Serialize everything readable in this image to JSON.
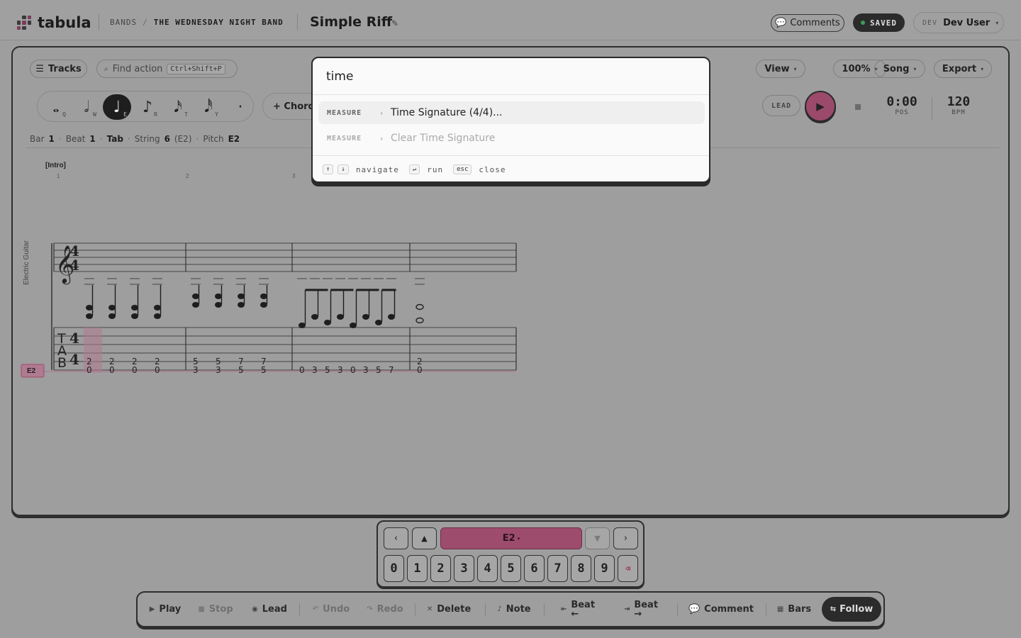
{
  "app": {
    "name": "tabula"
  },
  "breadcrumb": {
    "section": "BANDS",
    "separator": "/",
    "band": "THE WEDNESDAY NIGHT BAND"
  },
  "song": {
    "title": "Simple Riff",
    "edit_icon": "✎"
  },
  "header": {
    "comments_label": "Comments",
    "saved_label": "SAVED",
    "user_env": "DEV",
    "user_name": "Dev User"
  },
  "toolbar_top": {
    "tracks_label": "Tracks",
    "find_action_label": "Find action",
    "find_action_shortcut": "Ctrl+Shift+P",
    "view_label": "View",
    "zoom_label": "100%",
    "song_label": "Song",
    "export_label": "Export"
  },
  "durations": [
    {
      "glyph": "𝅝",
      "key": "Q"
    },
    {
      "glyph": "𝅗𝅥",
      "key": "W"
    },
    {
      "glyph": "♩",
      "key": "E",
      "active": true
    },
    {
      "glyph": "♪",
      "key": "R"
    },
    {
      "glyph": "𝅘𝅥𝅯",
      "key": "T"
    },
    {
      "glyph": "𝅘𝅥𝅰",
      "key": "Y"
    },
    {
      "glyph": "·",
      "key": ""
    }
  ],
  "chord_label": "+ Chord",
  "transport": {
    "lead_label": "LEAD",
    "position_value": "0:00",
    "position_label": "POS",
    "bpm_value": "120",
    "bpm_label": "BPM"
  },
  "status": {
    "bar_label": "Bar",
    "bar_value": "1",
    "beat_label": "Beat",
    "beat_value": "1",
    "mode_value": "Tab",
    "string_label": "String",
    "string_value": "6",
    "string_note": "(E2)",
    "pitch_label": "Pitch",
    "pitch_value": "E2"
  },
  "score": {
    "section_marker": "[Intro]",
    "track_name": "Electric Guitar",
    "time_signature": "4/4",
    "string_indicator": "E2",
    "measure_numbers": [
      "1",
      "2",
      "3"
    ],
    "measures": [
      {
        "notes": [
          {
            "top": "2",
            "bottom": "0"
          },
          {
            "top": "2",
            "bottom": "0"
          },
          {
            "top": "2",
            "bottom": "0"
          },
          {
            "top": "2",
            "bottom": "0"
          }
        ]
      },
      {
        "notes": [
          {
            "top": "5",
            "bottom": "3"
          },
          {
            "top": "5",
            "bottom": "3"
          },
          {
            "top": "7",
            "bottom": "5"
          },
          {
            "top": "7",
            "bottom": "5"
          }
        ]
      },
      {
        "notes": [
          {
            "bottom": "0"
          },
          {
            "bottom": "3"
          },
          {
            "bottom": "5"
          },
          {
            "bottom": "3"
          },
          {
            "bottom": "0"
          },
          {
            "bottom": "3"
          },
          {
            "bottom": "5"
          },
          {
            "bottom": "7"
          }
        ]
      },
      {
        "notes": [
          {
            "top": "2",
            "bottom": "0"
          }
        ]
      }
    ]
  },
  "palette": {
    "query": "time",
    "results": [
      {
        "category": "MEASURE",
        "label": "Time Signature (4/4)..."
      },
      {
        "category": "MEASURE",
        "label": "Clear Time Signature"
      }
    ],
    "footer": {
      "up_key": "↑",
      "down_key": "↓",
      "navigate_label": "navigate",
      "enter_key": "↵",
      "run_label": "run",
      "esc_key": "esc",
      "close_label": "close"
    }
  },
  "keypad": {
    "prev_label": "‹",
    "up_label": "▲",
    "string_label": "E2",
    "string_caret": "▾",
    "down_label": "▼",
    "next_label": "›",
    "digits": [
      "0",
      "1",
      "2",
      "3",
      "4",
      "5",
      "6",
      "7",
      "8",
      "9"
    ],
    "delete_label": "⌫"
  },
  "bottom_toolbar": {
    "play_label": "Play",
    "stop_label": "Stop",
    "lead_label": "Lead",
    "undo_label": "Undo",
    "redo_label": "Redo",
    "delete_label": "Delete",
    "note_label": "Note",
    "beat_back_label": "Beat",
    "beat_back_arrow": "←",
    "beat_fwd_label": "Beat",
    "beat_fwd_arrow": "→",
    "comment_label": "Comment",
    "bars_label": "Bars",
    "follow_label": "Follow"
  },
  "colors": {
    "accent": "#9d4c6d",
    "overlay_background": "#9e9e9f",
    "palette_background": "#fafafa",
    "saved_dot": "#3f9a56"
  }
}
